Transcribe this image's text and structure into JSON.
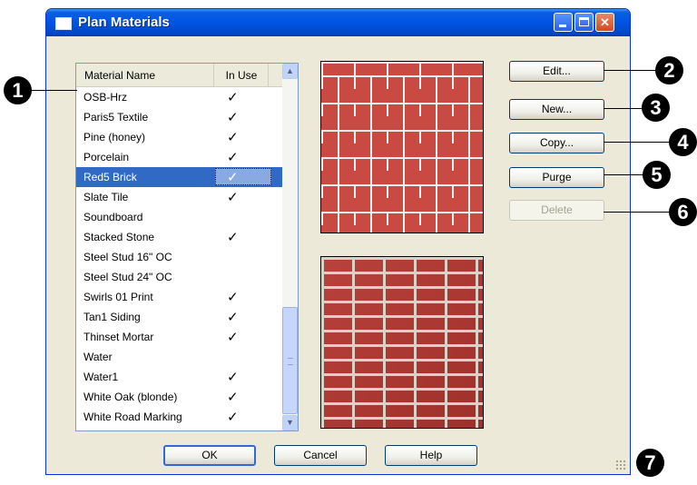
{
  "window": {
    "title": "Plan Materials"
  },
  "list": {
    "columns": {
      "name": "Material Name",
      "in_use": "In Use"
    },
    "rows": [
      {
        "name": "OSB-Hrz",
        "check": "✓"
      },
      {
        "name": "Paris5 Textile",
        "check": "✓"
      },
      {
        "name": "Pine (honey)",
        "check": "✓"
      },
      {
        "name": "Porcelain",
        "check": "✓"
      },
      {
        "name": "Red5 Brick",
        "check": "✓",
        "selected": true
      },
      {
        "name": "Slate Tile",
        "check": "✓"
      },
      {
        "name": "Soundboard",
        "check": ""
      },
      {
        "name": "Stacked Stone",
        "check": "✓"
      },
      {
        "name": "Steel Stud 16\" OC",
        "check": ""
      },
      {
        "name": "Steel Stud 24\" OC",
        "check": ""
      },
      {
        "name": "Swirls 01 Print",
        "check": "✓"
      },
      {
        "name": "Tan1 Siding",
        "check": "✓"
      },
      {
        "name": "Thinset Mortar",
        "check": "✓"
      },
      {
        "name": "Water",
        "check": ""
      },
      {
        "name": "Water1",
        "check": "✓"
      },
      {
        "name": "White Oak (blonde)",
        "check": "✓"
      },
      {
        "name": "White Road Marking",
        "check": "✓"
      }
    ]
  },
  "buttons": {
    "edit": "Edit...",
    "new": "New...",
    "copy": "Copy...",
    "purge": "Purge",
    "delete": "Delete",
    "ok": "OK",
    "cancel": "Cancel",
    "help": "Help"
  },
  "callouts": [
    "1",
    "2",
    "3",
    "4",
    "5",
    "6",
    "7"
  ],
  "colors": {
    "title_bar": "#0054e3",
    "selection": "#316ac5",
    "brick": "#c94a42",
    "dialog": "#ece9d8"
  }
}
